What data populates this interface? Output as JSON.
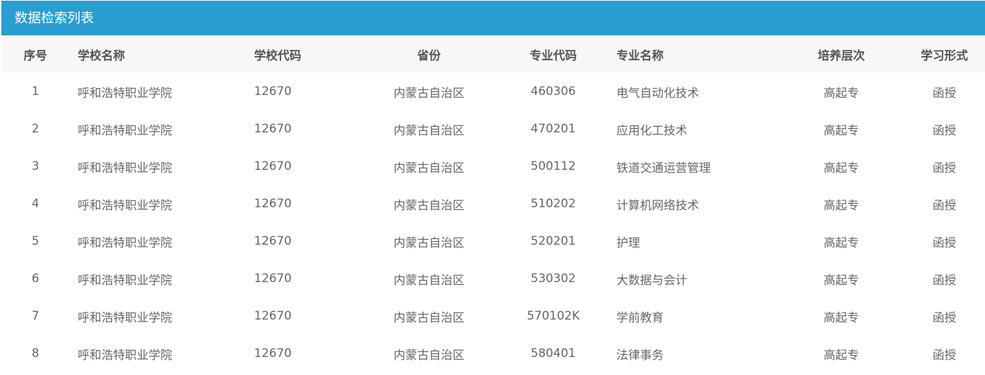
{
  "panel": {
    "title": "数据检索列表"
  },
  "colors": {
    "header_bg": "#289ed1",
    "table_head_bg": "#f7f7f7"
  },
  "table": {
    "headers": [
      "序号",
      "学校名称",
      "学校代码",
      "省份",
      "专业代码",
      "专业名称",
      "培养层次",
      "学习形式"
    ],
    "rows": [
      [
        "1",
        "呼和浩特职业学院",
        "12670",
        "内蒙古自治区",
        "460306",
        "电气自动化技术",
        "高起专",
        "函授"
      ],
      [
        "2",
        "呼和浩特职业学院",
        "12670",
        "内蒙古自治区",
        "470201",
        "应用化工技术",
        "高起专",
        "函授"
      ],
      [
        "3",
        "呼和浩特职业学院",
        "12670",
        "内蒙古自治区",
        "500112",
        "铁道交通运营管理",
        "高起专",
        "函授"
      ],
      [
        "4",
        "呼和浩特职业学院",
        "12670",
        "内蒙古自治区",
        "510202",
        "计算机网络技术",
        "高起专",
        "函授"
      ],
      [
        "5",
        "呼和浩特职业学院",
        "12670",
        "内蒙古自治区",
        "520201",
        "护理",
        "高起专",
        "函授"
      ],
      [
        "6",
        "呼和浩特职业学院",
        "12670",
        "内蒙古自治区",
        "530302",
        "大数据与会计",
        "高起专",
        "函授"
      ],
      [
        "7",
        "呼和浩特职业学院",
        "12670",
        "内蒙古自治区",
        "570102K",
        "学前教育",
        "高起专",
        "函授"
      ],
      [
        "8",
        "呼和浩特职业学院",
        "12670",
        "内蒙古自治区",
        "580401",
        "法律事务",
        "高起专",
        "函授"
      ]
    ]
  }
}
